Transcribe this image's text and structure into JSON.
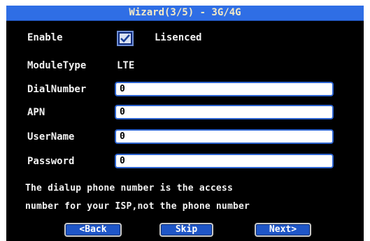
{
  "window": {
    "title": "Wizard(3/5) - 3G/4G"
  },
  "enable": {
    "label": "Enable",
    "checked": true,
    "option_label": "Lisenced"
  },
  "module_type": {
    "label": "ModuleType",
    "value": "LTE"
  },
  "fields": {
    "dial_number": {
      "label": "DialNumber",
      "value": "0"
    },
    "apn": {
      "label": "APN",
      "value": "0"
    },
    "user_name": {
      "label": "UserName",
      "value": "0"
    },
    "password": {
      "label": "Password",
      "value": "0"
    }
  },
  "hint": {
    "line1": "The dialup phone number is the access",
    "line2": "number for your ISP,not the phone number"
  },
  "buttons": {
    "back": "<Back",
    "skip": "Skip",
    "next": "Next>"
  },
  "colors": {
    "title_bar": "#2f6ee5",
    "background": "#000000",
    "field_border": "#2c63cf",
    "button": "#1f56c7"
  }
}
